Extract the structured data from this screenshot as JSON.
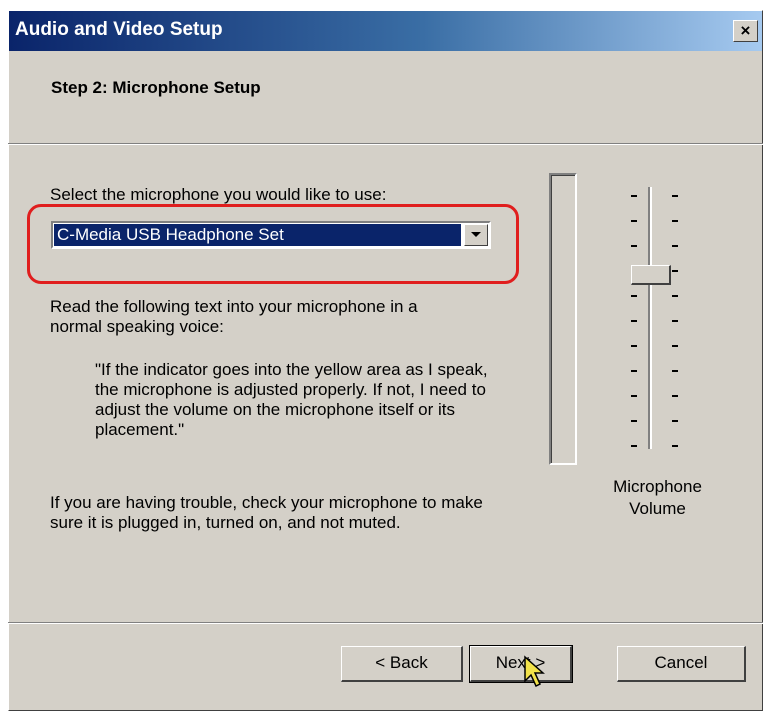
{
  "window": {
    "title": "Audio and Video Setup",
    "close_glyph": "×"
  },
  "header": {
    "step_title": "Step 2: Microphone Setup"
  },
  "microphone": {
    "select_label": "Select the microphone you would like to use:",
    "selected_device": "C-Media USB Headphone Set",
    "read_instruction": "Read the following text into your microphone in a normal speaking voice:",
    "quote": "\"If the indicator goes into the yellow area as I speak, the microphone is adjusted properly.  If not, I need to adjust the volume on the microphone itself or its placement.\"",
    "trouble_text": "If you are having trouble, check your microphone to make sure it is plugged in, turned on, and not muted."
  },
  "volume": {
    "label": "Microphone Volume",
    "level_fraction": 0.68
  },
  "buttons": {
    "back": "< Back",
    "next": "Next >",
    "cancel": "Cancel"
  },
  "colors": {
    "highlight": "#e01e1e",
    "selection": "#0a246a",
    "dialog_face": "#d4d0c8"
  }
}
